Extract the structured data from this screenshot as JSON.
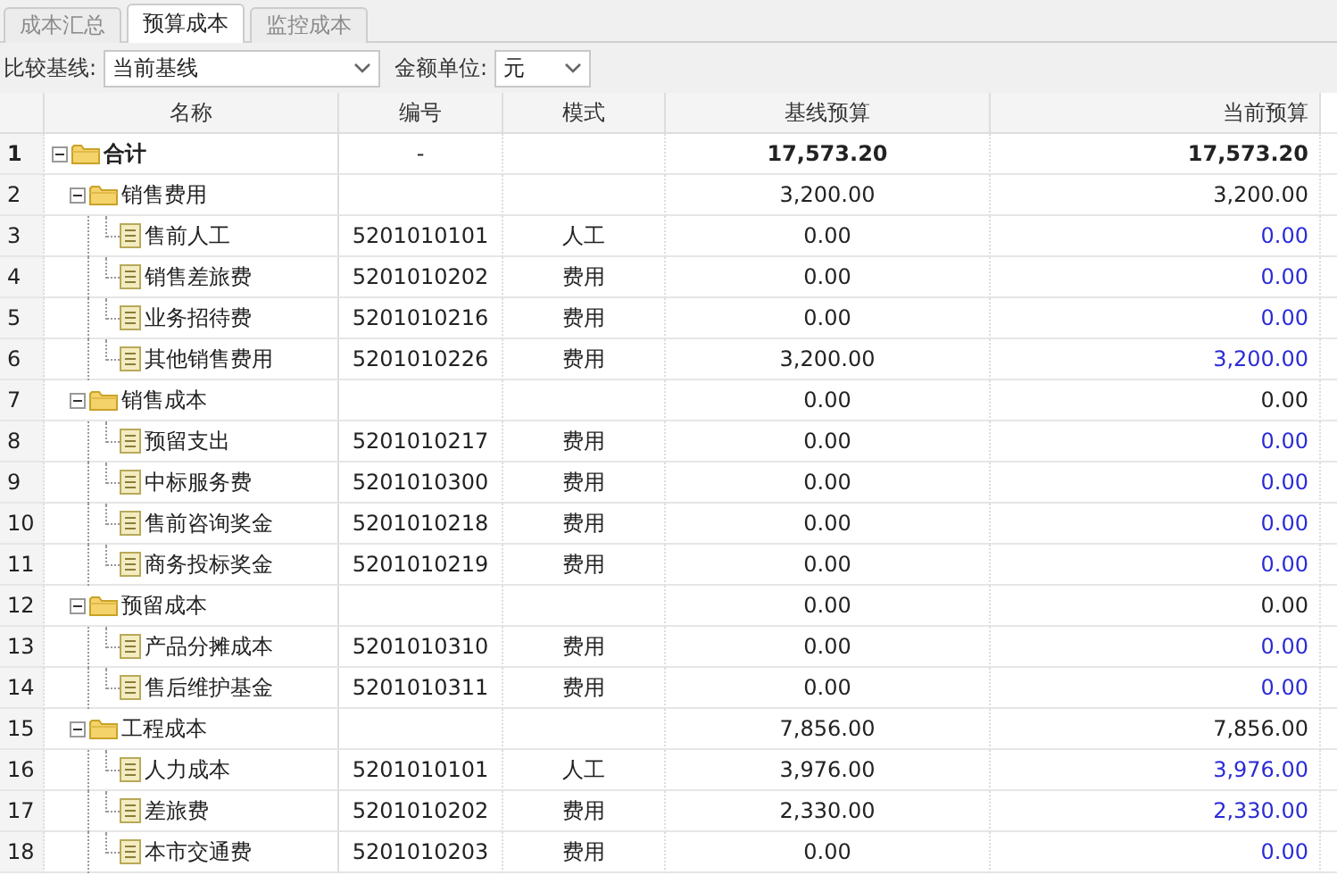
{
  "tabs": [
    {
      "label": "成本汇总",
      "selected": false
    },
    {
      "label": "预算成本",
      "selected": true
    },
    {
      "label": "监控成本",
      "selected": false
    }
  ],
  "toolbar": {
    "baseline_label": "比较基线:",
    "baseline_value": "当前基线",
    "unit_label": "金额单位:",
    "unit_value": "元"
  },
  "table": {
    "columns": [
      "名称",
      "编号",
      "模式",
      "基线预算",
      "当前预算"
    ],
    "rows": [
      {
        "no": "1",
        "kind": "folder",
        "name": "合计",
        "code": "-",
        "baseline": "17,573.20",
        "current": "17,573.20",
        "expanded": true,
        "children": [
          {
            "no": "2",
            "kind": "folder",
            "name": "销售费用",
            "baseline": "3,200.00",
            "current": "3,200.00",
            "expanded": true,
            "children": [
              {
                "no": "3",
                "kind": "item",
                "name": "售前人工",
                "code": "5201010101",
                "mode": "人工",
                "baseline": "0.00",
                "current": "0.00"
              },
              {
                "no": "4",
                "kind": "item",
                "name": "销售差旅费",
                "code": "5201010202",
                "mode": "费用",
                "baseline": "0.00",
                "current": "0.00"
              },
              {
                "no": "5",
                "kind": "item",
                "name": "业务招待费",
                "code": "5201010216",
                "mode": "费用",
                "baseline": "0.00",
                "current": "0.00"
              },
              {
                "no": "6",
                "kind": "item",
                "name": "其他销售费用",
                "code": "5201010226",
                "mode": "费用",
                "baseline": "3,200.00",
                "current": "3,200.00"
              }
            ]
          },
          {
            "no": "7",
            "kind": "folder",
            "name": "销售成本",
            "baseline": "0.00",
            "current": "0.00",
            "expanded": true,
            "children": [
              {
                "no": "8",
                "kind": "item",
                "name": "预留支出",
                "code": "5201010217",
                "mode": "费用",
                "baseline": "0.00",
                "current": "0.00"
              },
              {
                "no": "9",
                "kind": "item",
                "name": "中标服务费",
                "code": "5201010300",
                "mode": "费用",
                "baseline": "0.00",
                "current": "0.00"
              },
              {
                "no": "10",
                "kind": "item",
                "name": "售前咨询奖金",
                "code": "5201010218",
                "mode": "费用",
                "baseline": "0.00",
                "current": "0.00"
              },
              {
                "no": "11",
                "kind": "item",
                "name": "商务投标奖金",
                "code": "5201010219",
                "mode": "费用",
                "baseline": "0.00",
                "current": "0.00"
              }
            ]
          },
          {
            "no": "12",
            "kind": "folder",
            "name": "预留成本",
            "baseline": "0.00",
            "current": "0.00",
            "expanded": true,
            "children": [
              {
                "no": "13",
                "kind": "item",
                "name": "产品分摊成本",
                "code": "5201010310",
                "mode": "费用",
                "baseline": "0.00",
                "current": "0.00"
              },
              {
                "no": "14",
                "kind": "item",
                "name": "售后维护基金",
                "code": "5201010311",
                "mode": "费用",
                "baseline": "0.00",
                "current": "0.00"
              }
            ]
          },
          {
            "no": "15",
            "kind": "folder",
            "name": "工程成本",
            "baseline": "7,856.00",
            "current": "7,856.00",
            "expanded": true,
            "children": [
              {
                "no": "16",
                "kind": "item",
                "name": "人力成本",
                "code": "5201010101",
                "mode": "人工",
                "baseline": "3,976.00",
                "current": "3,976.00"
              },
              {
                "no": "17",
                "kind": "item",
                "name": "差旅费",
                "code": "5201010202",
                "mode": "费用",
                "baseline": "2,330.00",
                "current": "2,330.00"
              },
              {
                "no": "18",
                "kind": "item",
                "name": "本市交通费",
                "code": "5201010203",
                "mode": "费用",
                "baseline": "0.00",
                "current": "0.00"
              }
            ]
          }
        ]
      }
    ]
  }
}
